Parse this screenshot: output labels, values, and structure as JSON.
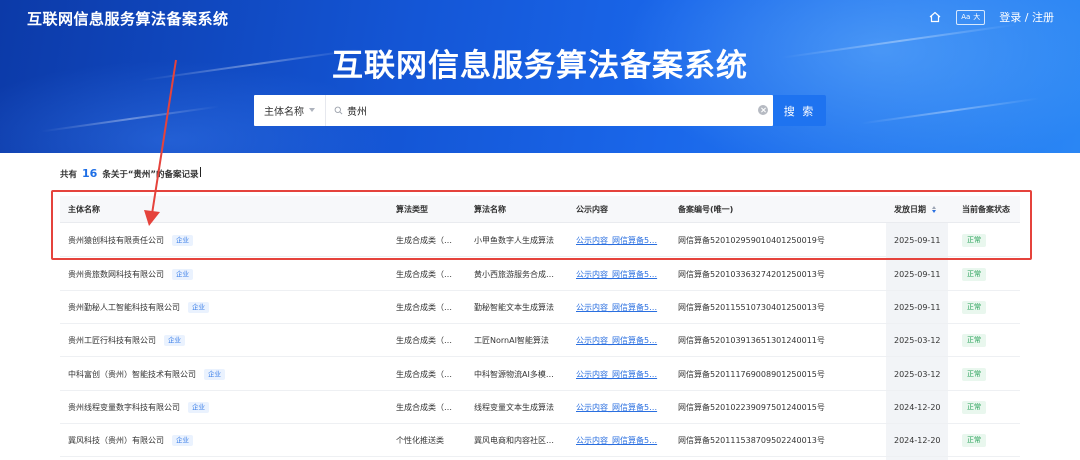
{
  "header": {
    "site_name": "互联网信息服务算法备案系统",
    "font_toggle_small": "Aa",
    "font_toggle_large": "大",
    "login_label": "登录 / 注册"
  },
  "hero": {
    "title": "互联网信息服务算法备案系统"
  },
  "search": {
    "select_value": "主体名称",
    "query": "贵州",
    "button_label": "搜 索"
  },
  "results": {
    "prefix": "共有",
    "count": "16",
    "suffix": "条关于“贵州”的备案记录"
  },
  "table": {
    "headers": [
      "主体名称",
      "算法类型",
      "算法名称",
      "公示内容",
      "备案编号(唯一)",
      "发放日期",
      "当前备案状态"
    ],
    "rows": [
      {
        "entity": "贵州猿创科技有限责任公司",
        "tag": "企业",
        "type": "生成合成类（…",
        "name": "小甲鱼数字人生成算法",
        "content": "公示内容_网信算备5…",
        "filing_no": "网信算备520102959010401250019号",
        "date": "2025-09-11",
        "status": "正常"
      },
      {
        "entity": "贵州贵旅数网科技有限公司",
        "tag": "企业",
        "type": "生成合成类（…",
        "name": "黄小西旅游服务合成…",
        "content": "公示内容_网信算备5…",
        "filing_no": "网信算备520103363274201250013号",
        "date": "2025-09-11",
        "status": "正常"
      },
      {
        "entity": "贵州勤秘人工智能科技有限公司",
        "tag": "企业",
        "type": "生成合成类（…",
        "name": "勤秘智能文本生成算法",
        "content": "公示内容_网信算备5…",
        "filing_no": "网信算备520115510730401250013号",
        "date": "2025-09-11",
        "status": "正常"
      },
      {
        "entity": "贵州工匠行科技有限公司",
        "tag": "企业",
        "type": "生成合成类（…",
        "name": "工匠NornAI智能算法",
        "content": "公示内容_网信算备5…",
        "filing_no": "网信算备520103913651301240011号",
        "date": "2025-03-12",
        "status": "正常"
      },
      {
        "entity": "中科富创（贵州）智能技术有限公司",
        "tag": "企业",
        "type": "生成合成类（…",
        "name": "中科智源物流AI多模…",
        "content": "公示内容_网信算备5…",
        "filing_no": "网信算备520111769008901250015号",
        "date": "2025-03-12",
        "status": "正常"
      },
      {
        "entity": "贵州线程变量数字科技有限公司",
        "tag": "企业",
        "type": "生成合成类（…",
        "name": "线程变量文本生成算法",
        "content": "公示内容_网信算备5…",
        "filing_no": "网信算备520102239097501240015号",
        "date": "2024-12-20",
        "status": "正常"
      },
      {
        "entity": "冀风科技（贵州）有限公司",
        "tag": "企业",
        "type": "个性化推送类",
        "name": "冀风电商和内容社区…",
        "content": "公示内容_网信算备5…",
        "filing_no": "网信算备520111538709502240013号",
        "date": "2024-12-20",
        "status": "正常"
      }
    ]
  },
  "colors": {
    "primary": "#1e73f0",
    "link": "#2a6fe0",
    "status_ok": "#27a158",
    "annotation": "#e5433c"
  },
  "icons": [
    "home-icon",
    "font-size-icon",
    "search-icon",
    "clear-icon",
    "caret-down-icon",
    "sort-icon"
  ]
}
